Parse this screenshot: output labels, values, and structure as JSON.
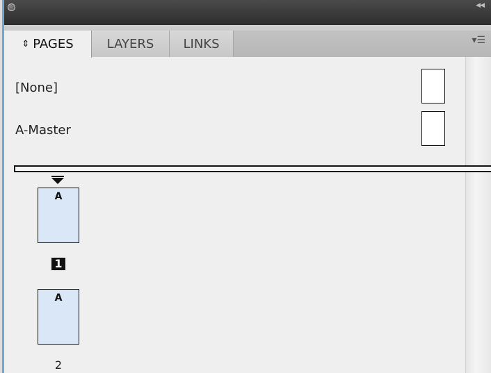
{
  "panel": {
    "tabs": [
      {
        "label": "PAGES",
        "active": true
      },
      {
        "label": "LAYERS",
        "active": false
      },
      {
        "label": "LINKS",
        "active": false
      }
    ],
    "sort_icon": "sort-up-down-icon",
    "menu_icon": "panel-menu-icon",
    "collapse_icon": "collapse-arrows-icon"
  },
  "masters": [
    {
      "label": "[None]"
    },
    {
      "label": "A-Master"
    }
  ],
  "pages": [
    {
      "master_prefix": "A",
      "number": "1",
      "selected": true
    },
    {
      "master_prefix": "A",
      "number": "2",
      "selected": false
    }
  ],
  "colors": {
    "title_bar": "#333333",
    "panel_bg": "#efefef",
    "page_fill": "#d9e7f7",
    "selection_border": "#6fa7cf"
  }
}
